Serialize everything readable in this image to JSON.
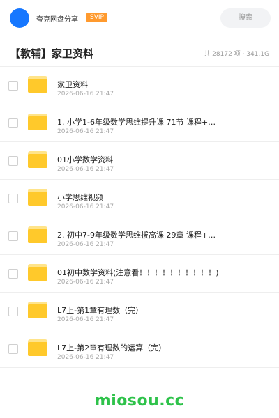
{
  "header": {
    "username": "夸克网盘分享",
    "badge": "SVIP",
    "search_label": "搜索",
    "colors": {
      "avatar": "#1677ff",
      "badge": "#ff9a2e"
    }
  },
  "title_bar": {
    "title": "【教辅】家卫资料",
    "meta": "共 28172 项 · 341.1G"
  },
  "files": [
    {
      "name": "家卫资料",
      "date": "2026-06-16 21:47",
      "icon": "folder-icon"
    },
    {
      "name": "1. 小学1-6年级数学思维提升课 71节 课程+…",
      "date": "2026-06-16 21:47",
      "icon": "folder-icon"
    },
    {
      "name": "01小学数学资料",
      "date": "2026-06-16 21:47",
      "icon": "folder-icon"
    },
    {
      "name": "小学思维视频",
      "date": "2026-06-16 21:47",
      "icon": "folder-icon"
    },
    {
      "name": "2. 初中7-9年级数学思维拔高课 29章 课程+…",
      "date": "2026-06-16 21:47",
      "icon": "folder-icon"
    },
    {
      "name": "01初中数学资料(注意看！！！！！！！！！！)",
      "date": "2026-06-16 21:47",
      "icon": "folder-icon"
    },
    {
      "name": "L7上-第1章有理数（完）",
      "date": "2026-06-16 21:47",
      "icon": "folder-icon"
    },
    {
      "name": "L7上-第2章有理数的运算（完）",
      "date": "2026-06-16 21:47",
      "icon": "folder-icon"
    }
  ],
  "footer": {
    "watermark": "miosou.cc",
    "watermark_color": "#2ec24a"
  }
}
